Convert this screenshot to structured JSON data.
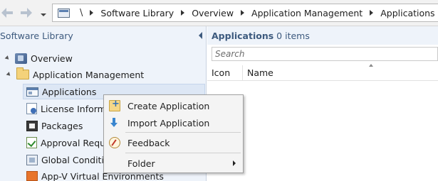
{
  "toolbar": {
    "back_icon": "back-arrow-icon",
    "forward_icon": "forward-arrow-icon",
    "history_icon": "chevron-down-icon"
  },
  "breadcrumb": {
    "root": "\\",
    "items": [
      "Software Library",
      "Overview",
      "Application Management",
      "Applications"
    ]
  },
  "nav_pane": {
    "title": "Software Library",
    "items": [
      {
        "label": "Overview",
        "icon": "overview-icon"
      },
      {
        "label": "Application Management",
        "icon": "folder-icon"
      },
      {
        "label": "Applications",
        "icon": "application-icon"
      },
      {
        "label": "License Informat",
        "icon": "license-icon"
      },
      {
        "label": "Packages",
        "icon": "package-icon"
      },
      {
        "label": "Approval Reques",
        "icon": "approval-icon"
      },
      {
        "label": "Global Condition",
        "icon": "global-condition-icon"
      },
      {
        "label": "App-V Virtual Environments",
        "icon": "appv-icon"
      }
    ]
  },
  "content": {
    "title": "Applications",
    "count": "0 items",
    "search_placeholder": "Search",
    "columns": [
      "Icon",
      "Name"
    ]
  },
  "context_menu": {
    "items": [
      {
        "label": "Create Application",
        "icon": "create-application-icon"
      },
      {
        "label": "Import Application",
        "icon": "import-application-icon"
      },
      {
        "label": "Feedback",
        "icon": "feedback-icon"
      },
      {
        "label": "Folder",
        "icon": "chevron-right-icon"
      }
    ]
  },
  "colors": {
    "pane_background": "#eef3fa",
    "pane_title": "#3d5a7e",
    "selection": "#dde7f5"
  }
}
